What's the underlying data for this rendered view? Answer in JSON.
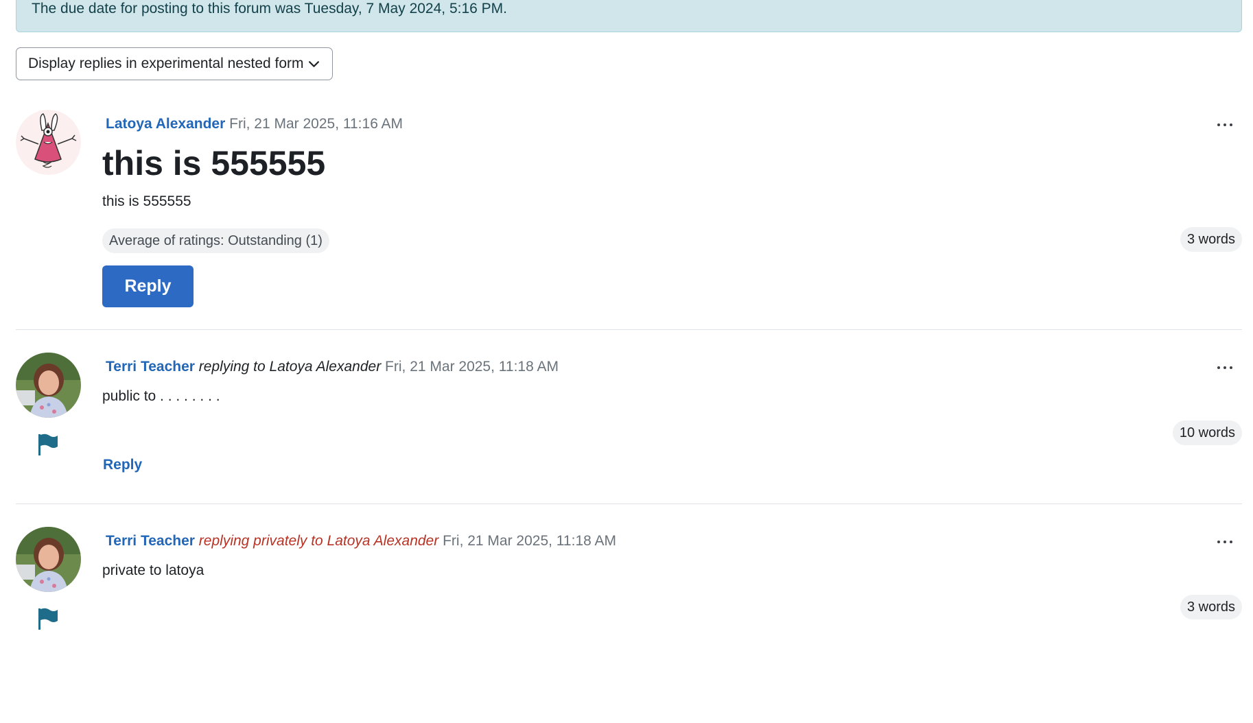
{
  "alert": {
    "text": "The due date for posting to this forum was Tuesday, 7 May 2024, 5:16 PM."
  },
  "display_mode": {
    "selected": "Display replies in experimental nested form",
    "icon": "chevron-down-icon"
  },
  "posts": [
    {
      "author": "Latoya Alexander",
      "replying_text": "",
      "date": "Fri, 21 Mar 2025, 11:16 AM",
      "title": "this is 555555",
      "body": "this is 555555",
      "ratings": "Average of ratings: Outstanding (1)",
      "word_count": "3 words",
      "reply_label": "Reply",
      "avatar": "cartoon-monster-avatar"
    },
    {
      "author": "Terri Teacher",
      "replying_text": "replying to Latoya Alexander",
      "date": "Fri, 21 Mar 2025, 11:18 AM",
      "body": "public to . . . . . . . .",
      "word_count": "10 words",
      "reply_label": "Reply",
      "avatar": "teacher-photo-avatar",
      "flag_icon": "flag-icon"
    },
    {
      "author": "Terri Teacher",
      "replying_text": "replying privately to Latoya Alexander",
      "date": "Fri, 21 Mar 2025, 11:18 AM",
      "body": "private to latoya",
      "word_count": "3 words",
      "avatar": "teacher-photo-avatar",
      "flag_icon": "flag-icon"
    }
  ],
  "colors": {
    "link": "#2266b7",
    "private": "#b83224",
    "primary_button": "#2d6ac4",
    "alert_bg": "#d1e6ea",
    "flag": "#1f6b8a"
  }
}
